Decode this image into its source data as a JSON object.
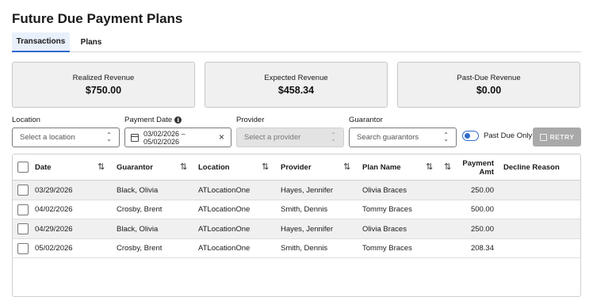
{
  "page_title": "Future Due Payment Plans",
  "tabs": [
    {
      "label": "Transactions",
      "active": true
    },
    {
      "label": "Plans",
      "active": false
    }
  ],
  "summary_cards": [
    {
      "label": "Realized Revenue",
      "value": "$750.00"
    },
    {
      "label": "Expected Revenue",
      "value": "$458.34"
    },
    {
      "label": "Past-Due Revenue",
      "value": "$0.00"
    }
  ],
  "filters": {
    "location": {
      "label": "Location",
      "placeholder": "Select a location"
    },
    "payment_date": {
      "label": "Payment Date",
      "value_line1": "03/02/2026 –",
      "value_line2": "05/02/2026"
    },
    "provider": {
      "label": "Provider",
      "placeholder": "Select a provider",
      "disabled": true
    },
    "guarantor": {
      "label": "Guarantor",
      "placeholder": "Search guarantors"
    },
    "past_due_only": {
      "label": "Past Due Only",
      "checked": false
    },
    "retry_label": "RETRY"
  },
  "table": {
    "headers": {
      "date": "Date",
      "guarantor": "Guarantor",
      "location": "Location",
      "provider": "Provider",
      "plan_name": "Plan Name",
      "payment_amt_line1": "Payment",
      "payment_amt_line2": "Amt",
      "decline_reason": "Decline Reason"
    },
    "rows": [
      {
        "date": "03/29/2026",
        "guarantor": "Black, Olivia",
        "location": "ATLocationOne",
        "provider": "Hayes, Jennifer",
        "plan_name": "Olivia Braces",
        "payment_amt": "250.00",
        "decline_reason": ""
      },
      {
        "date": "04/02/2026",
        "guarantor": "Crosby, Brent",
        "location": "ATLocationOne",
        "provider": "Smith, Dennis",
        "plan_name": "Tommy Braces",
        "payment_amt": "500.00",
        "decline_reason": ""
      },
      {
        "date": "04/29/2026",
        "guarantor": "Black, Olivia",
        "location": "ATLocationOne",
        "provider": "Hayes, Jennifer",
        "plan_name": "Olivia Braces",
        "payment_amt": "250.00",
        "decline_reason": ""
      },
      {
        "date": "05/02/2026",
        "guarantor": "Crosby, Brent",
        "location": "ATLocationOne",
        "provider": "Smith, Dennis",
        "plan_name": "Tommy Braces",
        "payment_amt": "208.34",
        "decline_reason": ""
      }
    ]
  },
  "colors": {
    "accent": "#2f6bcc",
    "card_bg": "#f0f0f0",
    "retry_disabled": "#a9a9a9"
  }
}
